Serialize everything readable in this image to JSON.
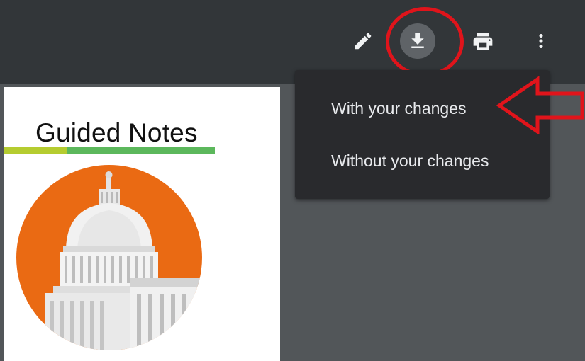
{
  "toolbar": {
    "buttons": [
      {
        "name": "edit",
        "icon": "pencil-icon"
      },
      {
        "name": "download",
        "icon": "download-icon",
        "active": true
      },
      {
        "name": "print",
        "icon": "printer-icon"
      },
      {
        "name": "more",
        "icon": "more-vert-icon"
      }
    ]
  },
  "download_menu": {
    "items": [
      {
        "label": "With your changes"
      },
      {
        "label": "Without your changes"
      }
    ]
  },
  "document": {
    "title": "Guided Notes",
    "rule_colors": [
      "#b5cc30",
      "#5cb85c"
    ],
    "badge_color": "#ea6a13"
  },
  "annotations": {
    "color": "#e0141b"
  }
}
